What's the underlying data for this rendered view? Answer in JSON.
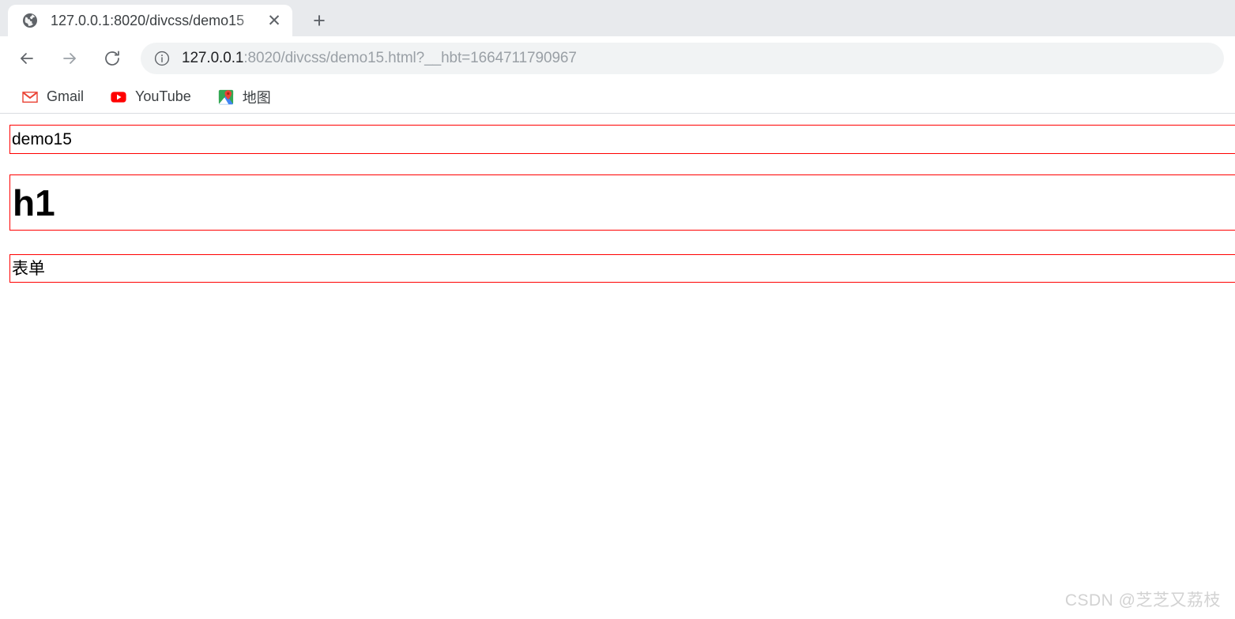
{
  "browser": {
    "tab": {
      "favicon": "globe-icon",
      "title": "127.0.0.1:8020/divcss/demo15",
      "close_label": "✕"
    },
    "new_tab_label": "+",
    "toolbar": {
      "back_icon": "back-arrow-icon",
      "forward_icon": "forward-arrow-icon",
      "reload_icon": "reload-icon",
      "site_info_icon": "info-circle-icon",
      "url_host": "127.0.0.1",
      "url_rest": ":8020/divcss/demo15.html?__hbt=1664711790967",
      "url_full": "127.0.0.1:8020/divcss/demo15.html?__hbt=1664711790967"
    },
    "bookmarks": [
      {
        "icon": "gmail-icon",
        "label": "Gmail"
      },
      {
        "icon": "youtube-icon",
        "label": "YouTube"
      },
      {
        "icon": "google-maps-icon",
        "label": "地图"
      }
    ]
  },
  "page": {
    "border_color": "#ff0000",
    "blocks": [
      {
        "kind": "paragraph",
        "text": "demo15"
      },
      {
        "kind": "heading1",
        "text": "h1"
      },
      {
        "kind": "form",
        "text": "表单"
      }
    ]
  },
  "watermark": {
    "text": "CSDN @芝芝又荔枝"
  }
}
